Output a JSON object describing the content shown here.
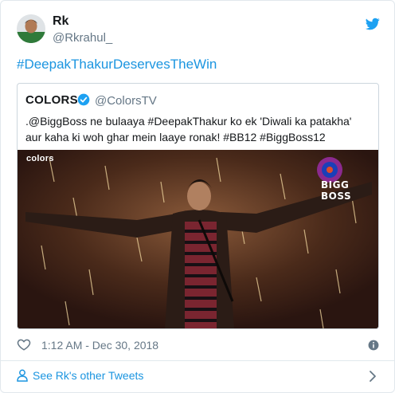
{
  "tweet": {
    "author_name": "Rk",
    "author_handle": "@Rkrahul_",
    "hashtag_text": "#DeepakThakurDeservesTheWin",
    "timestamp": "1:12 AM - Dec 30, 2018"
  },
  "quoted_tweet": {
    "author_name": "COLORS",
    "author_handle": "@ColorsTV",
    "text": ".@BiggBoss ne bulaaya #DeepakThakur ko ek 'Diwali ka patakha' aur kaha ki woh ghar mein laaye ronak! #BB12 #BiggBoss12",
    "media_brand_left": "colors",
    "media_brand_right": "BIGG BOSS"
  },
  "footer": {
    "see_tweets_label": "See Rk's other Tweets"
  },
  "colors": {
    "link_blue": "#1b95e0",
    "muted_gray": "#657786",
    "border": "#e1e8ed",
    "twitter_blue": "#1da1f2"
  },
  "icons": [
    "twitter-bird-icon",
    "verified-badge-icon",
    "heart-icon",
    "info-icon",
    "person-icon",
    "chevron-right-icon"
  ]
}
